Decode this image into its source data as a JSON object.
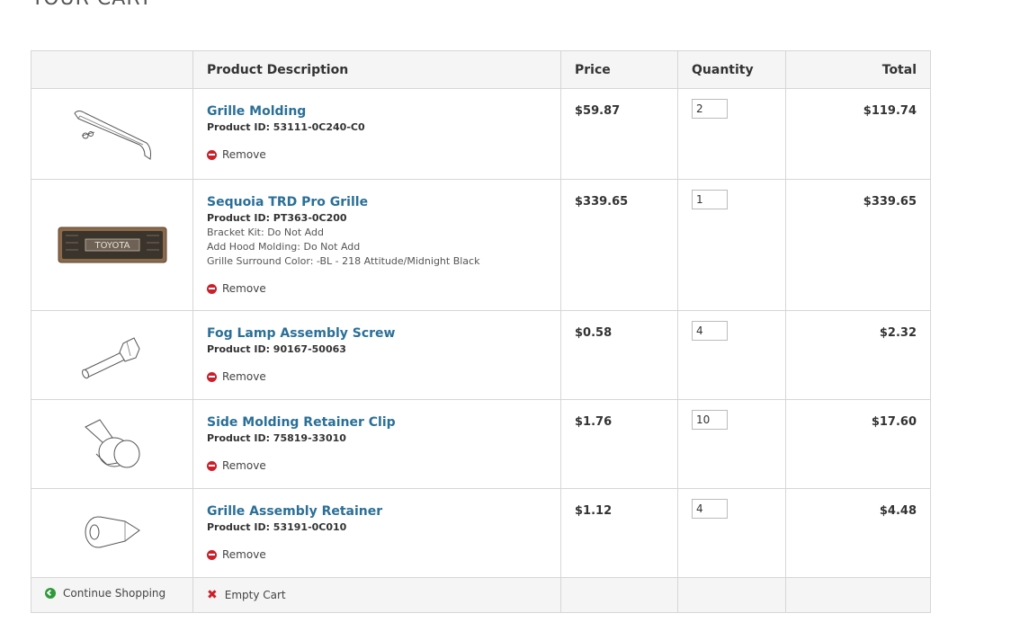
{
  "page": {
    "title": "YOUR CART"
  },
  "table": {
    "headers": {
      "image": "",
      "description": "Product Description",
      "price": "Price",
      "quantity": "Quantity",
      "total": "Total"
    },
    "remove_label": "Remove",
    "items": [
      {
        "name": "Grille Molding",
        "product_id": "Product ID: 53111-0C240-C0",
        "options": [],
        "price": "$59.87",
        "quantity": "2",
        "total": "$119.74",
        "image_icon": "grille-molding-image"
      },
      {
        "name": "Sequoia TRD Pro Grille",
        "product_id": "Product ID: PT363-0C200",
        "options": [
          "Bracket Kit: Do Not Add",
          "Add Hood Molding: Do Not Add",
          "Grille Surround Color: -BL - 218 Attitude/Midnight Black"
        ],
        "price": "$339.65",
        "quantity": "1",
        "total": "$339.65",
        "image_icon": "trd-pro-grille-image",
        "image_text": "TOYOTA"
      },
      {
        "name": "Fog Lamp Assembly Screw",
        "product_id": "Product ID: 90167-50063",
        "options": [],
        "price": "$0.58",
        "quantity": "4",
        "total": "$2.32",
        "image_icon": "screw-image"
      },
      {
        "name": "Side Molding Retainer Clip",
        "product_id": "Product ID: 75819-33010",
        "options": [],
        "price": "$1.76",
        "quantity": "10",
        "total": "$17.60",
        "image_icon": "retainer-clip-image"
      },
      {
        "name": "Grille Assembly Retainer",
        "product_id": "Product ID: 53191-0C010",
        "options": [],
        "price": "$1.12",
        "quantity": "4",
        "total": "$4.48",
        "image_icon": "grille-retainer-image"
      }
    ]
  },
  "footer": {
    "continue_label": "Continue Shopping",
    "empty_label": "Empty Cart"
  },
  "colors": {
    "link": "#2a6f97",
    "remove": "#cc1f2a",
    "continue": "#2e9b3a",
    "header_bg": "#f5f5f5",
    "border": "#d6d6d6"
  }
}
